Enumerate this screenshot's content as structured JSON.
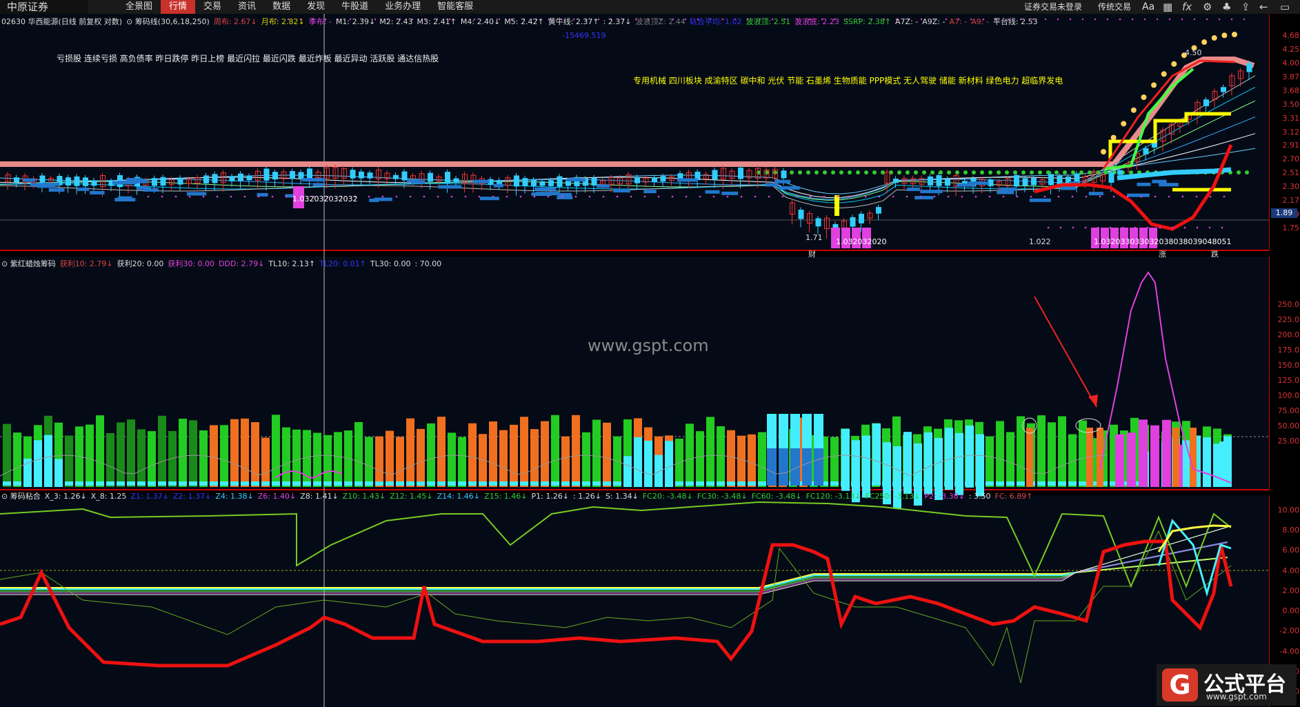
{
  "app": {
    "logo": "中原证券"
  },
  "menu": [
    "全景图",
    "行情",
    "交易",
    "资讯",
    "数据",
    "发现",
    "牛股道",
    "业务办理",
    "智能客服"
  ],
  "menu_active": 1,
  "topright": {
    "login": "证券交易未登录",
    "mode": "传统交易",
    "font_icon": "Aa"
  },
  "icons": [
    "grid-icon",
    "fx-icon",
    "gear-icon",
    "shirt-icon",
    "upload-icon",
    "back-icon",
    "minimize-icon"
  ],
  "info1": [
    {
      "t": "02630 华西能源(日线 前复权 对数)",
      "c": "#ddd"
    },
    {
      "t": "⊙ 筹码线(30,6,18,250)",
      "c": "#ddd"
    },
    {
      "t": "周布: 2.67↓",
      "c": "#d44"
    },
    {
      "t": "月布: 2.82↓",
      "c": "#d4d400"
    },
    {
      "t": "季布: -",
      "c": "#e040e0"
    },
    {
      "t": "M1: 2.39↓",
      "c": "#ddd"
    },
    {
      "t": "M2: 2.43",
      "c": "#ddd"
    },
    {
      "t": "M3: 2.41↑",
      "c": "#ddd"
    },
    {
      "t": "M4: 2.40↓",
      "c": "#ddd"
    },
    {
      "t": "M5: 2.42↑",
      "c": "#ddd"
    },
    {
      "t": "黄牛线: 2.37↑",
      "c": "#ddd"
    },
    {
      "t": ": 2.37↓",
      "c": "#ddd"
    },
    {
      "t": "波浪顶Z: 2.44",
      "c": "#777"
    },
    {
      "t": "轨合平均: 1.02",
      "c": "#33f"
    },
    {
      "t": "波浪顶: 2.51",
      "c": "#3c3"
    },
    {
      "t": "波浪底: 2.23",
      "c": "#e040e0"
    },
    {
      "t": "SSRP: 2.38↑",
      "c": "#3c3"
    },
    {
      "t": "A7Z: -",
      "c": "#ddd"
    },
    {
      "t": "A9Z: -",
      "c": "#ddd"
    },
    {
      "t": "A7: -",
      "c": "#d44"
    },
    {
      "t": "A9: -",
      "c": "#d44"
    },
    {
      "t": "平台线: 2.53",
      "c": "#ddd"
    }
  ],
  "price_low_marker": "-15469.519",
  "note_left": "亏损股 连续亏损 高负债率 昨日跌停 昨日上榜 最近闪拉 最近闪跌 最近炸板 最近异动 活跃股 通达信热股",
  "note_right": "专用机械 四川板块 成渝特区 碳中和 光伏 节能 石墨烯 生物质能 PPP模式 无人驾驶 储能 新材料 绿色电力 超临界发电",
  "price_labels": {
    "low": "1.71",
    "mid": "1.022",
    "chip_left": "1.032032032032",
    "chip_mid": "1.032032020",
    "chip_right": "1.032033033032038038039048051",
    "high": "4.50",
    "cai": "财",
    "zhang": "涨",
    "die": "跌"
  },
  "axis1": [
    "4.68",
    "4.25",
    "4.00",
    "3.87",
    "3.68",
    "3.50",
    "3.31",
    "3.12",
    "2.91",
    "2.70",
    "2.51",
    "2.30",
    "2.17",
    "1.89",
    "1.75"
  ],
  "price_tag": "1.89",
  "info2": [
    {
      "t": "⊙ 紫红蜡烛筹码",
      "c": "#ddd"
    },
    {
      "t": "获利10: 2.79↓",
      "c": "#d44"
    },
    {
      "t": "获利20: 0.00",
      "c": "#ddd"
    },
    {
      "t": "获利30: 0.00",
      "c": "#e040e0"
    },
    {
      "t": "DDD: 2.79↓",
      "c": "#e040e0"
    },
    {
      "t": "TL10: 2.13↑",
      "c": "#ddd"
    },
    {
      "t": "TL20: 0.01↑",
      "c": "#33f"
    },
    {
      "t": "TL30: 0.00",
      "c": "#ddd"
    },
    {
      "t": ": 70.00",
      "c": "#ddd"
    }
  ],
  "axis2": [
    "250.0",
    "225.0",
    "200.0",
    "175.0",
    "150.0",
    "125.0",
    "100.0",
    "75.00",
    "50.00",
    "25.00"
  ],
  "info3": [
    {
      "t": "⊙ 筹码粘合",
      "c": "#ddd"
    },
    {
      "t": "X_3: 1.26↓",
      "c": "#ddd"
    },
    {
      "t": "X_8: 1.25",
      "c": "#ddd"
    },
    {
      "t": "Z1: 1.37↓",
      "c": "#33f"
    },
    {
      "t": "Z2: 1.37↓",
      "c": "#33f"
    },
    {
      "t": "Z4: 1.38↓",
      "c": "#3cf"
    },
    {
      "t": "Z6: 1.40↓",
      "c": "#e040e0"
    },
    {
      "t": "Z8: 1.41↓",
      "c": "#ddd"
    },
    {
      "t": "Z10: 1.43↓",
      "c": "#3c3"
    },
    {
      "t": "Z12: 1.45↓",
      "c": "#3c3"
    },
    {
      "t": "Z14: 1.46↓",
      "c": "#3cf"
    },
    {
      "t": "Z15: 1.46↓",
      "c": "#3c3"
    },
    {
      "t": "P1: 1.26↓",
      "c": "#ddd"
    },
    {
      "t": ": 1.26↓",
      "c": "#ddd"
    },
    {
      "t": "S: 1.34↓",
      "c": "#ddd"
    },
    {
      "t": "FC20: -3.48↓",
      "c": "#3c3"
    },
    {
      "t": "FC30: -3.48↓",
      "c": "#3c3"
    },
    {
      "t": "FC60: -3.48↓",
      "c": "#3c3"
    },
    {
      "t": "FC120: -3.13↓",
      "c": "#3c3"
    },
    {
      "t": "FC250: -3.13↓",
      "c": "#3c3"
    },
    {
      "t": "P2: -3.38↓",
      "c": "#e040e0"
    },
    {
      "t": ": 3.50",
      "c": "#ddd"
    },
    {
      "t": "FC: 6.89↑",
      "c": "#d44"
    }
  ],
  "axis3": [
    "10.00",
    "8.00",
    "6.00",
    "4.00",
    "2.00",
    "0.00",
    "-2.00",
    "-4.00",
    "-6.00",
    "-8.00"
  ],
  "watermark": "www.gspt.com",
  "brand": {
    "mark": "G",
    "title": "公式平台",
    "url": "www.gspt.com"
  }
}
